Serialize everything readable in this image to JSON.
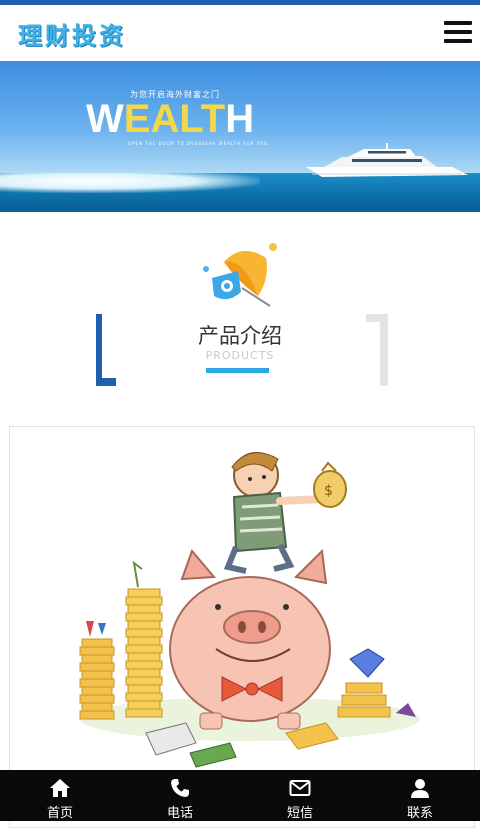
{
  "header": {
    "logo_text": "理财投资"
  },
  "banner": {
    "tagline": "为您开启海外财富之门",
    "headline_white_1": "W",
    "headline_yellow": "EALT",
    "headline_white_2": "H",
    "subline": "OPEN THE DOOR TO OVERSEAS WEALTH FOR YOU"
  },
  "section": {
    "title": "产品介绍",
    "subtitle": "PRODUCTS"
  },
  "bottom_nav": {
    "items": [
      {
        "label": "首页",
        "icon": "home-icon"
      },
      {
        "label": "电话",
        "icon": "phone-icon"
      },
      {
        "label": "短信",
        "icon": "envelope-icon"
      },
      {
        "label": "联系",
        "icon": "user-icon"
      }
    ]
  },
  "colors": {
    "accent_blue": "#2ba9e6",
    "brand_dark_blue": "#1f5fae",
    "nav_bg": "#0a0a0a"
  }
}
